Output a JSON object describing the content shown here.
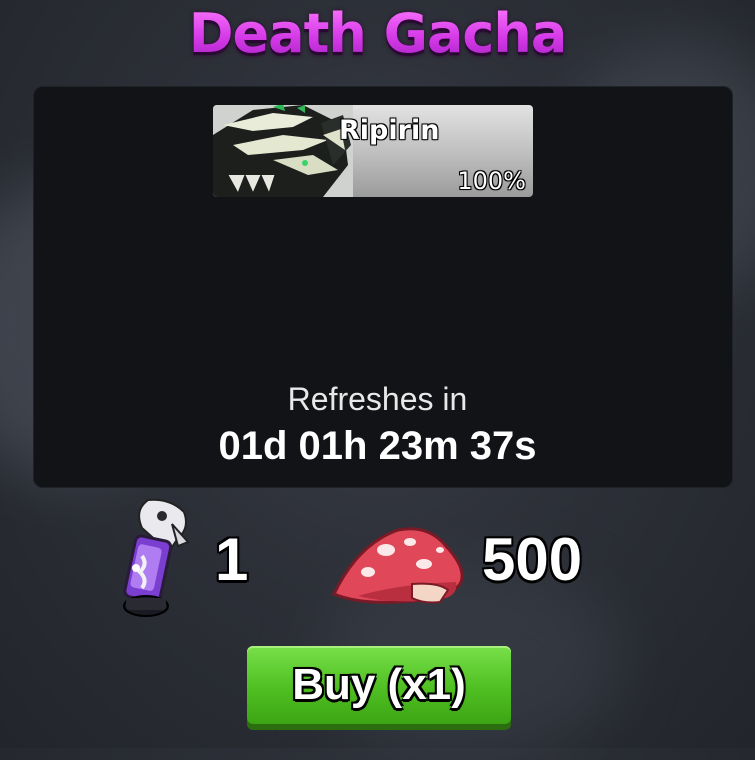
{
  "title": "Death Gacha",
  "reward": {
    "name": "Ripirin",
    "chance": "100%",
    "icon": "dragon-portrait-icon"
  },
  "refresh": {
    "label": "Refreshes in",
    "time": "01d 01h 23m 37s"
  },
  "cost": {
    "ticket_icon": "skull-vial-icon",
    "ticket_count": "1",
    "currency_icon": "red-mushroom-icon",
    "price": "500"
  },
  "buy_button": {
    "label": "Buy (x1)"
  },
  "colors": {
    "title": "#d63be8",
    "button": "#4fbf22",
    "panel": "#111316"
  }
}
